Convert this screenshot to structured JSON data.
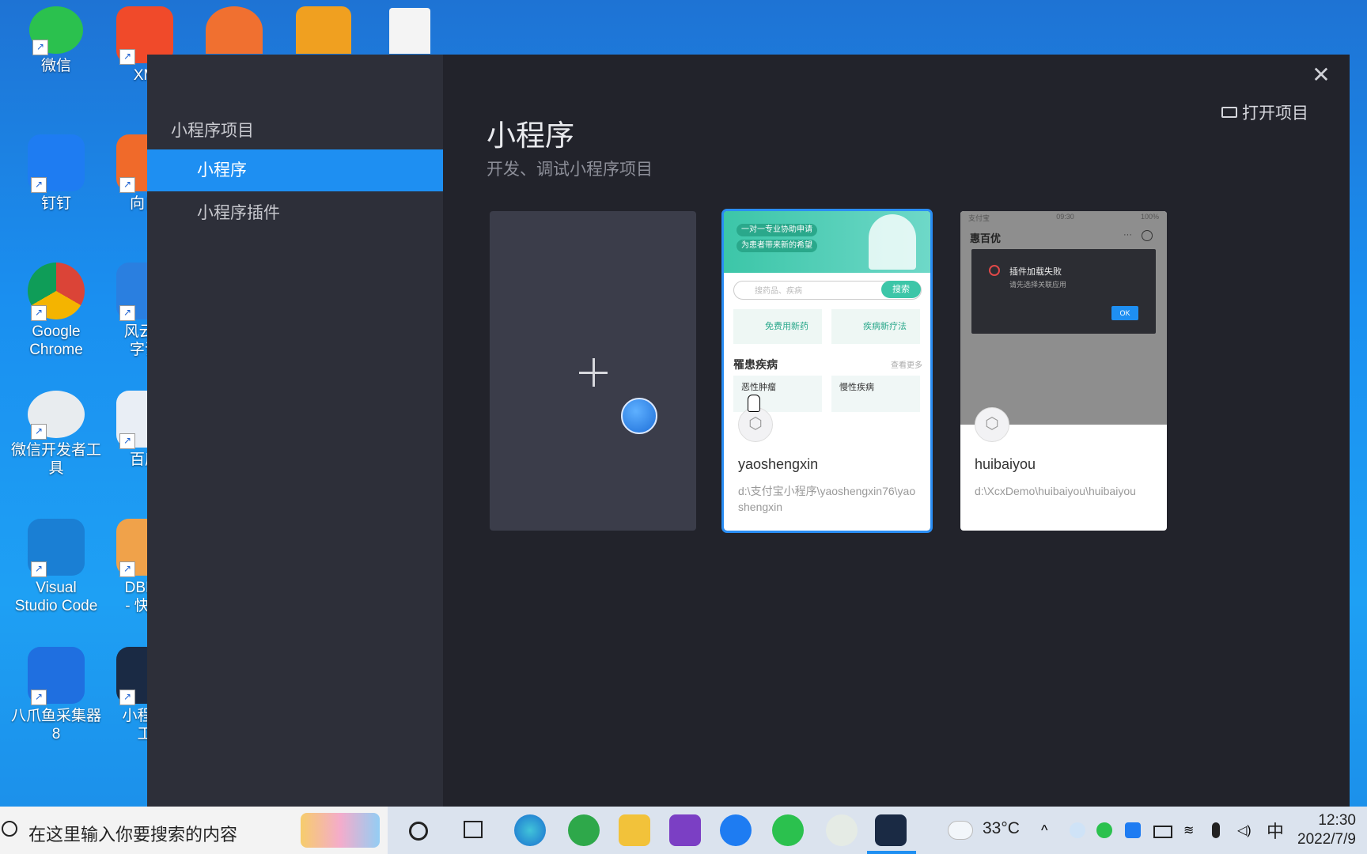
{
  "desktop": {
    "icons": [
      {
        "label": "微信",
        "icon": "wechat-icon"
      },
      {
        "label": "XM",
        "icon": "xmind-icon"
      },
      {
        "label": "钉钉",
        "icon": "dingtalk-icon"
      },
      {
        "label": "向日",
        "icon": "sunlogin-icon"
      },
      {
        "label": "Google Chrome",
        "icon": "chrome-icon"
      },
      {
        "label": "风云O\n字识",
        "icon": "ocr-icon"
      },
      {
        "label": "微信开发者工具",
        "icon": "wechat-devtools-icon"
      },
      {
        "label": "百度",
        "icon": "baidu-icon"
      },
      {
        "label": "Visual Studio Code",
        "icon": "vscode-icon"
      },
      {
        "label": "DBDo\n- 快捷",
        "icon": "dbdo-icon"
      },
      {
        "label": "八爪鱼采集器 8",
        "icon": "octopus-icon"
      },
      {
        "label": "小程序\n工",
        "icon": "miniprogram-tool-icon"
      }
    ]
  },
  "dialog": {
    "sidebar": {
      "heading": "小程序项目",
      "items": [
        {
          "label": "小程序",
          "active": true
        },
        {
          "label": "小程序插件",
          "active": false
        }
      ]
    },
    "open_project_label": "打开项目",
    "title": "小程序",
    "subtitle": "开发、调试小程序项目",
    "projects": [
      {
        "name": "yaoshengxin",
        "path": "d:\\支付宝小程序\\yaoshengxin76\\yaoshengxin",
        "selected": true,
        "preview": {
          "tags": [
            "一对一专业协助申请",
            "为患者带来新的希望"
          ],
          "search_placeholder": "搜药品、疾病",
          "search_button": "搜索",
          "boxes": [
            "免费用新药",
            "疾病新疗法"
          ],
          "section": "罹患疾病",
          "more": "查看更多",
          "diseases": [
            "恶性肿瘤",
            "慢性疾病"
          ]
        }
      },
      {
        "name": "huibaiyou",
        "path": "d:\\XcxDemo\\huibaiyou\\huibaiyou",
        "selected": false,
        "preview": {
          "status_left": "支付宝",
          "status_time": "09:30",
          "status_right": "100%",
          "app_title": "惠百优",
          "error_title": "插件加载失败",
          "error_sub": "请先选择关联应用",
          "ok": "OK"
        }
      }
    ]
  },
  "taskbar": {
    "search_placeholder": "在这里输入你要搜索的内容",
    "weather": "33°C",
    "ime": "中",
    "time": "12:30",
    "date": "2022/7/9"
  },
  "colors": {
    "accent": "#1e8ff2",
    "dialog_bg": "#22232b",
    "sidebar_bg": "#2d2f39"
  }
}
